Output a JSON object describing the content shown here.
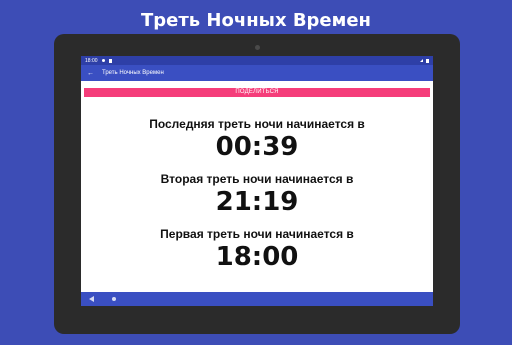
{
  "promo": {
    "title": "Треть Ночных Времен"
  },
  "status_bar": {
    "time": "18:00"
  },
  "app_bar": {
    "title": "Треть Ночных Времен"
  },
  "share": {
    "label": "ПОДЕЛИТЬСЯ"
  },
  "times": [
    {
      "label": "Последняя треть ночи начинается в",
      "value": "00:39"
    },
    {
      "label": "Вторая треть ночи начинается в",
      "value": "21:19"
    },
    {
      "label": "Первая треть ночи начинается в",
      "value": "18:00"
    }
  ],
  "colors": {
    "background": "#3d4db6",
    "app_bar": "#3a4fc2",
    "status_bar": "#2e3fa7",
    "share_button": "#f53d7a"
  },
  "icons": {
    "back": "arrow-left-icon",
    "nav_back": "nav-back-icon",
    "nav_home": "nav-home-icon"
  }
}
